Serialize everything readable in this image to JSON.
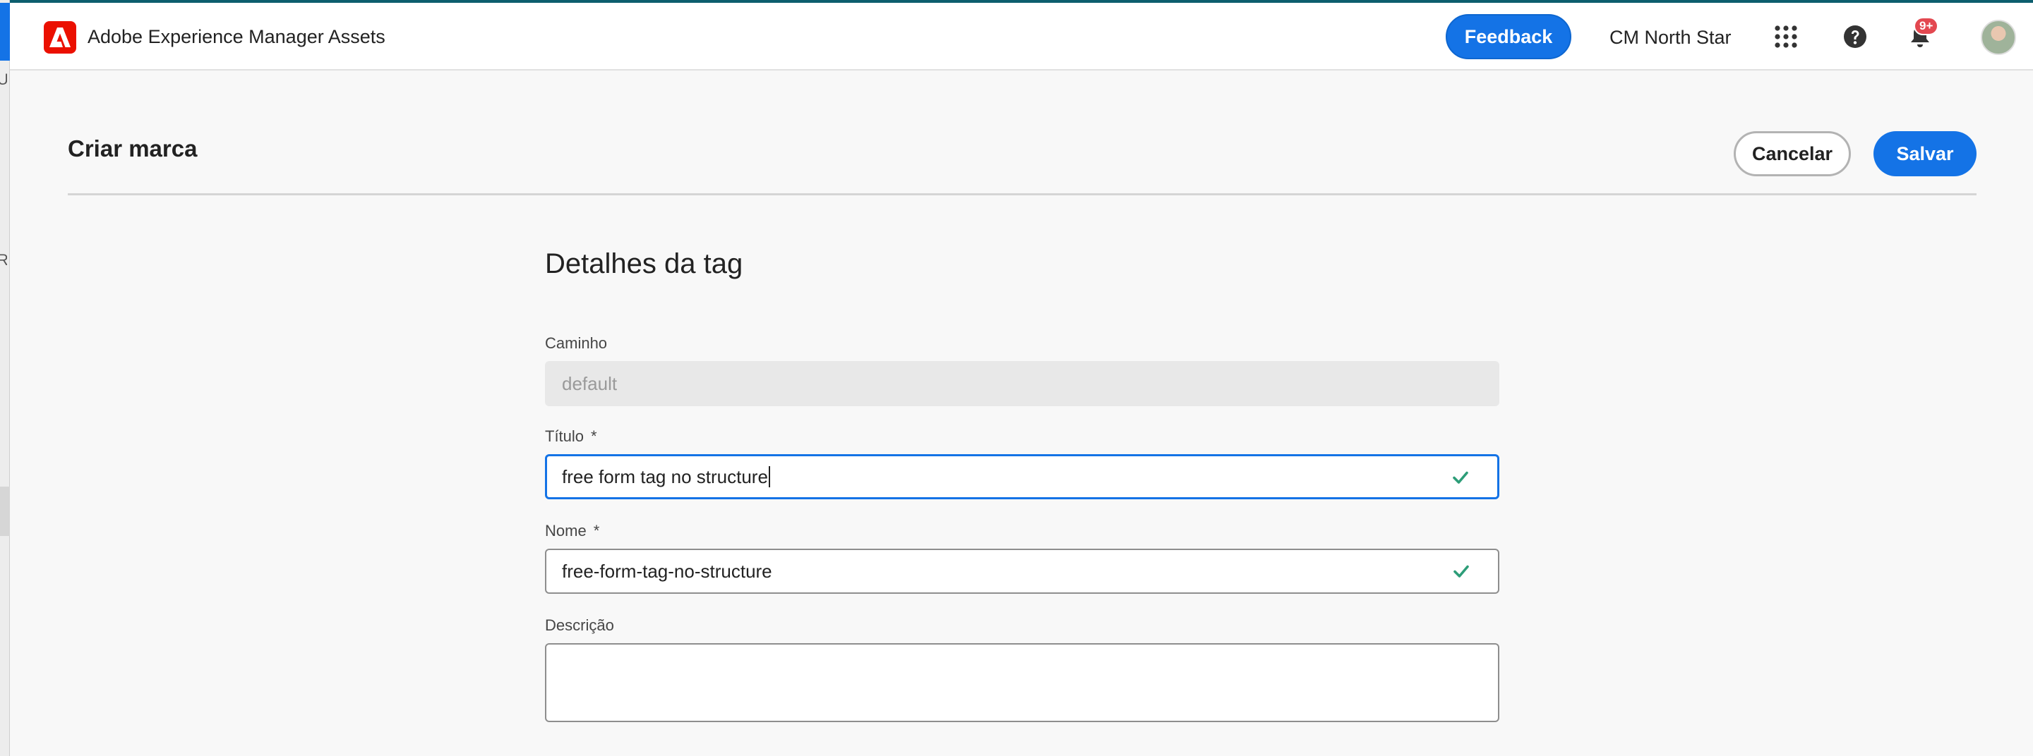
{
  "app": {
    "title": "Adobe Experience Manager Assets",
    "feedback_label": "Feedback",
    "org_name": "CM North Star",
    "notifications_badge": "9+",
    "icons": [
      "adobe-logo-icon",
      "apps-grid-icon",
      "help-icon",
      "bell-icon",
      "avatar"
    ],
    "accent_color": "#1473e6",
    "logo_color": "#eb1000"
  },
  "page": {
    "title": "Criar marca",
    "cancel_label": "Cancelar",
    "save_label": "Salvar"
  },
  "form": {
    "section_title": "Detalhes da tag",
    "path": {
      "label": "Caminho",
      "value": "default"
    },
    "title_field": {
      "label": "Título",
      "required_mark": "*",
      "value": "free form tag no structure"
    },
    "name_field": {
      "label": "Nome",
      "required_mark": "*",
      "value": "free-form-tag-no-structure"
    },
    "description": {
      "label": "Descrição",
      "value": ""
    },
    "valid_color": "#2d9d78"
  },
  "background_window": {
    "glyphs": [
      "Ui",
      "R"
    ]
  }
}
